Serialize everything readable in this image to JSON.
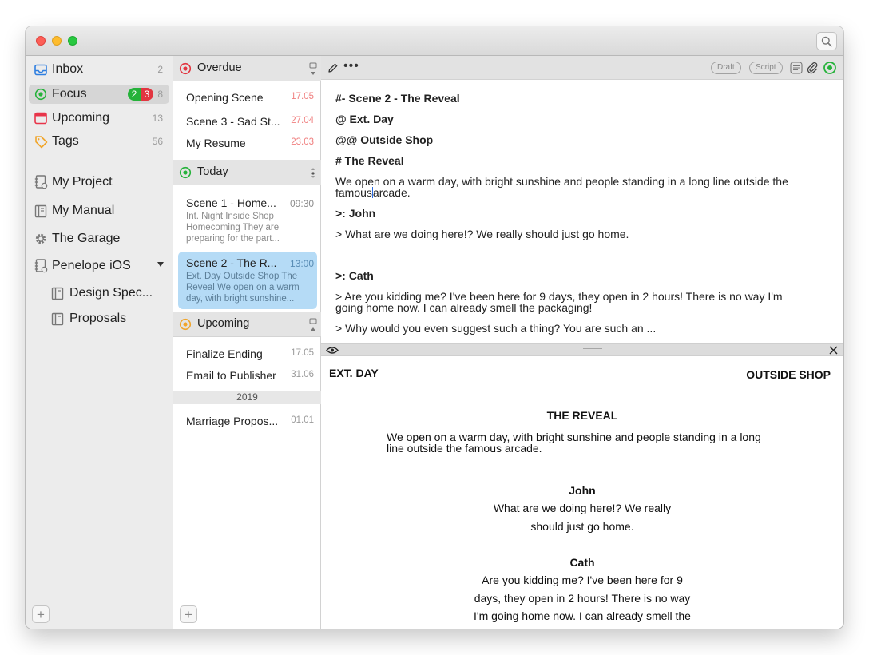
{
  "sidebar": {
    "smart": [
      {
        "label": "Inbox",
        "count": "2",
        "icon": "inbox-icon"
      },
      {
        "label": "Focus",
        "count": "8",
        "badge_green": "2",
        "badge_red": "3",
        "icon": "focus-icon"
      },
      {
        "label": "Upcoming",
        "count": "13",
        "icon": "calendar-icon"
      },
      {
        "label": "Tags",
        "count": "56",
        "icon": "tag-icon"
      }
    ],
    "projects": [
      {
        "label": "My Project",
        "icon": "notebook-icon"
      },
      {
        "label": "My Manual",
        "icon": "book-icon"
      },
      {
        "label": "The Garage",
        "icon": "gear-icon"
      },
      {
        "label": "Penelope iOS",
        "icon": "notebook-icon"
      }
    ],
    "subitems": [
      {
        "label": "Design Spec..."
      },
      {
        "label": "Proposals"
      }
    ]
  },
  "middle": {
    "overdue": {
      "title": "Overdue",
      "items": [
        {
          "title": "Opening Scene",
          "date": "17.05"
        },
        {
          "title": "Scene 3 - Sad St...",
          "date": "27.04"
        },
        {
          "title": "My Resume",
          "date": "23.03"
        }
      ]
    },
    "today": {
      "title": "Today",
      "cards": [
        {
          "title": "Scene 1 - Home...",
          "time": "09:30",
          "desc": "Int. Night Inside Shop Homecoming They are preparing for the part..."
        },
        {
          "title": "Scene 2 - The R...",
          "time": "13:00",
          "desc": "Ext. Day Outside Shop The Reveal We open on a warm day, with bright sunshine..."
        }
      ]
    },
    "upcoming": {
      "title": "Upcoming",
      "items": [
        {
          "title": "Finalize Ending",
          "date": "17.05"
        },
        {
          "title": "Email to Publisher",
          "date": "31.06"
        }
      ],
      "year": "2019",
      "later": [
        {
          "title": "Marriage Propos...",
          "date": "01.01"
        }
      ]
    }
  },
  "editor": {
    "toolbar": {
      "draft": "Draft",
      "script": "Script"
    },
    "lines": {
      "l1": "#- Scene 2 - The Reveal",
      "l2": "@ Ext. Day",
      "l3": "@@ Outside Shop",
      "l4": "# The Reveal",
      "p1a": "We open on a warm day, with bright sunshine and people standing in a long line outside the",
      "p1b_pre": "famous",
      "p1b_post": "arcade.",
      "l5": ">: John",
      "l6": "> What are we doing here!? We really should just go home.",
      "l7": ">: Cath",
      "l8a": "> Are you kidding me? I've been here for 9 days, they open in 2 hours! There is no way I'm",
      "l8b": "going home now. I can already smell the packaging!",
      "l9": "> Why would you even suggest such a thing? You are such an ..."
    }
  },
  "preview": {
    "slug_left": "EXT. DAY",
    "slug_right": "OUTSIDE SHOP",
    "heading": "THE REVEAL",
    "action_a": "We open on a warm day, with bright sunshine and people standing in a long",
    "action_b": "line outside the famous arcade.",
    "char1": "John",
    "d1a": "What are we doing here!? We really",
    "d1b": "should just go home.",
    "char2": "Cath",
    "d2a": "Are you kidding me? I've been here for 9",
    "d2b": "days, they open in 2 hours! There is no way",
    "d2c": "I'm going home now. I can already smell the"
  },
  "colors": {
    "accent_green": "#25b23a",
    "accent_red": "#e23540",
    "selection_blue": "#b5dbf6",
    "overdue_date": "#f08080"
  }
}
